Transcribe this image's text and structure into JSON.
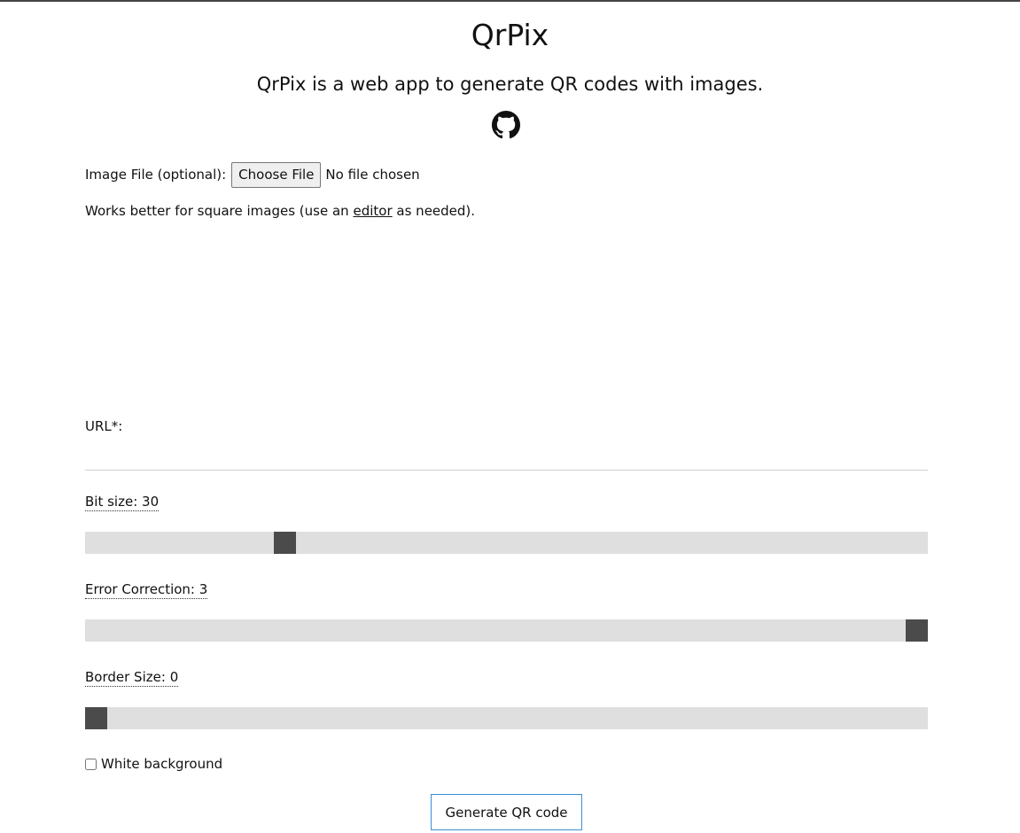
{
  "header": {
    "title": "QrPix",
    "subtitle": "QrPix is a web app to generate QR codes with images.",
    "github_icon": "github-icon"
  },
  "image_file": {
    "label": "Image File (optional):",
    "button_label": "Choose File",
    "status": "No file chosen"
  },
  "note": {
    "prefix": "Works better for square images (use an",
    "link": "editor",
    "suffix": "as needed)."
  },
  "url": {
    "label": "URL*:",
    "value": ""
  },
  "sliders": {
    "bit_size": {
      "label": "Bit size:",
      "value": "30",
      "fraction": 0.23
    },
    "error_correction": {
      "label": "Error Correction:",
      "value": "3",
      "fraction": 1.0
    },
    "border_size": {
      "label": "Border Size:",
      "value": "0",
      "fraction": 0.0
    }
  },
  "white_background": {
    "label": "White background",
    "checked": false
  },
  "generate_button": {
    "label": "Generate QR code"
  },
  "colors": {
    "track": "#dfdfdf",
    "thumb": "#4b4b4b",
    "button_border": "#3b8fd6"
  }
}
